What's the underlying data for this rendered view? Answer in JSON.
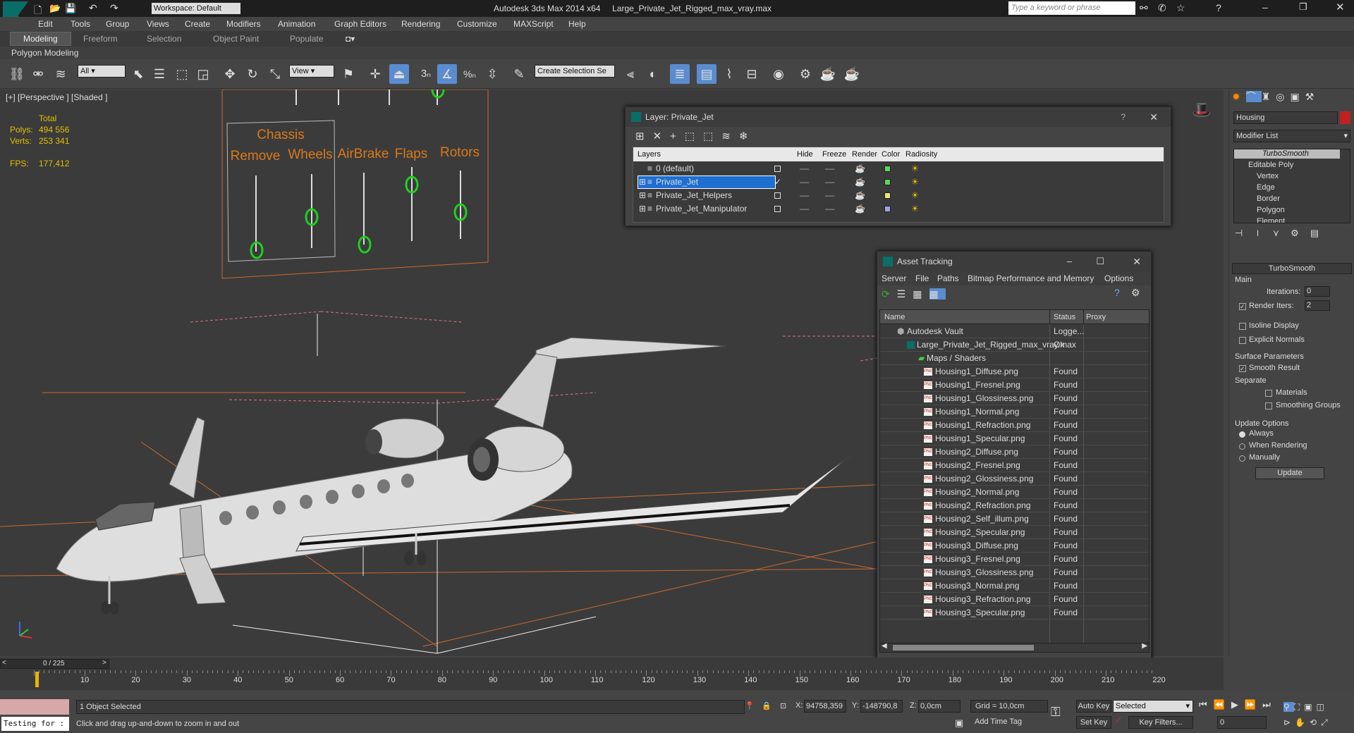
{
  "window": {
    "title": "Autodesk 3ds Max  2014 x64",
    "filename": "Large_Private_Jet_Rigged_max_vray.max",
    "workspace": "Workspace: Default",
    "search_placeholder": "Type a keyword or phrase"
  },
  "menu": [
    "Edit",
    "Tools",
    "Group",
    "Views",
    "Create",
    "Modifiers",
    "Animation",
    "Graph Editors",
    "Rendering",
    "Customize",
    "MAXScript",
    "Help"
  ],
  "ribbon": {
    "tabs": [
      "Modeling",
      "Freeform",
      "Selection",
      "Object Paint",
      "Populate"
    ],
    "subtab": "Polygon Modeling"
  },
  "toolbar": {
    "filter": "All",
    "refcoord": "View",
    "selection_set": "Create Selection Se"
  },
  "viewport": {
    "label": "[+] [Perspective ] [Shaded ]",
    "stats": {
      "total_label": "Total",
      "polys_label": "Polys:",
      "polys": "494 556",
      "verts_label": "Verts:",
      "verts": "253 341",
      "fps_label": "FPS:",
      "fps": "177,412"
    },
    "rig_labels": {
      "chassis": "Chassis",
      "remove": "Remove",
      "wheels": "Wheels",
      "airbrake": "AirBrake",
      "flaps": "Flaps",
      "rotors": "Rotors"
    }
  },
  "layer_dialog": {
    "title": "Layer: Private_Jet",
    "columns": [
      "Layers",
      "Hide",
      "Freeze",
      "Render",
      "Color",
      "Radiosity"
    ],
    "layers": [
      {
        "name": "0 (default)",
        "color": "#5fd35f",
        "selected": false
      },
      {
        "name": "Private_Jet",
        "color": "#5fd35f",
        "selected": true
      },
      {
        "name": "Private_Jet_Helpers",
        "color": "#e8e87a",
        "selected": false
      },
      {
        "name": "Private_Jet_Manipulator",
        "color": "#a0a0e8",
        "selected": false
      }
    ]
  },
  "asset_tracking": {
    "title": "Asset Tracking",
    "menu": [
      "Server",
      "File",
      "Paths",
      "Bitmap Performance and Memory",
      "Options"
    ],
    "columns": [
      "Name",
      "Status",
      "Proxy"
    ],
    "vault": {
      "name": "Autodesk Vault",
      "status": "Logge..."
    },
    "file": {
      "name": "Large_Private_Jet_Rigged_max_vray.max",
      "status": "Ok"
    },
    "maps_group": "Maps / Shaders",
    "maps": [
      {
        "name": "Housing1_Diffuse.png",
        "status": "Found"
      },
      {
        "name": "Housing1_Fresnel.png",
        "status": "Found"
      },
      {
        "name": "Housing1_Glossiness.png",
        "status": "Found"
      },
      {
        "name": "Housing1_Normal.png",
        "status": "Found"
      },
      {
        "name": "Housing1_Refraction.png",
        "status": "Found"
      },
      {
        "name": "Housing1_Specular.png",
        "status": "Found"
      },
      {
        "name": "Housing2_Diffuse.png",
        "status": "Found"
      },
      {
        "name": "Housing2_Fresnel.png",
        "status": "Found"
      },
      {
        "name": "Housing2_Glossiness.png",
        "status": "Found"
      },
      {
        "name": "Housing2_Normal.png",
        "status": "Found"
      },
      {
        "name": "Housing2_Refraction.png",
        "status": "Found"
      },
      {
        "name": "Housing2_Self_illum.png",
        "status": "Found"
      },
      {
        "name": "Housing2_Specular.png",
        "status": "Found"
      },
      {
        "name": "Housing3_Diffuse.png",
        "status": "Found"
      },
      {
        "name": "Housing3_Fresnel.png",
        "status": "Found"
      },
      {
        "name": "Housing3_Glossiness.png",
        "status": "Found"
      },
      {
        "name": "Housing3_Normal.png",
        "status": "Found"
      },
      {
        "name": "Housing3_Refraction.png",
        "status": "Found"
      },
      {
        "name": "Housing3_Specular.png",
        "status": "Found"
      }
    ],
    "png_badge": "PNG"
  },
  "command_panel": {
    "object_name": "Housing",
    "modifier_list": "Modifier List",
    "stack": [
      "TurboSmooth",
      "Editable Poly",
      "Vertex",
      "Edge",
      "Border",
      "Polygon",
      "Element"
    ],
    "rollout_title": "TurboSmooth",
    "main_label": "Main",
    "iterations_label": "Iterations:",
    "iterations": "0",
    "render_iters_label": "Render Iters:",
    "render_iters": "2",
    "isoline": "Isoline Display",
    "explicit_normals": "Explicit Normals",
    "surface_params": "Surface Parameters",
    "smooth_result": "Smooth Result",
    "separate": "Separate",
    "materials": "Materials",
    "smoothing_groups": "Smoothing Groups",
    "update_options": "Update Options",
    "always": "Always",
    "when_rendering": "When Rendering",
    "manually": "Manually",
    "update_button": "Update"
  },
  "timeline": {
    "frame": "0 / 225",
    "ticks": [
      "10",
      "20",
      "30",
      "40",
      "50",
      "60",
      "70",
      "80",
      "90",
      "100",
      "110",
      "120",
      "130",
      "140",
      "150",
      "160",
      "170",
      "180",
      "190",
      "200",
      "210",
      "220"
    ],
    "prev": "<",
    "next": ">"
  },
  "status": {
    "script_box": "Testing for :",
    "selected": "1 Object Selected",
    "prompt": "Click and drag up-and-down to zoom in and out",
    "x_label": "X:",
    "x": "94758,359",
    "y_label": "Y:",
    "y": "-148790,8",
    "z_label": "Z:",
    "z": "0,0cm",
    "grid": "Grid = 10,0cm",
    "add_time_tag": "Add Time Tag",
    "auto_key": "Auto Key",
    "set_key": "Set Key",
    "key_mode": "Selected",
    "key_filters": "Key Filters...",
    "frame_field": "0"
  }
}
